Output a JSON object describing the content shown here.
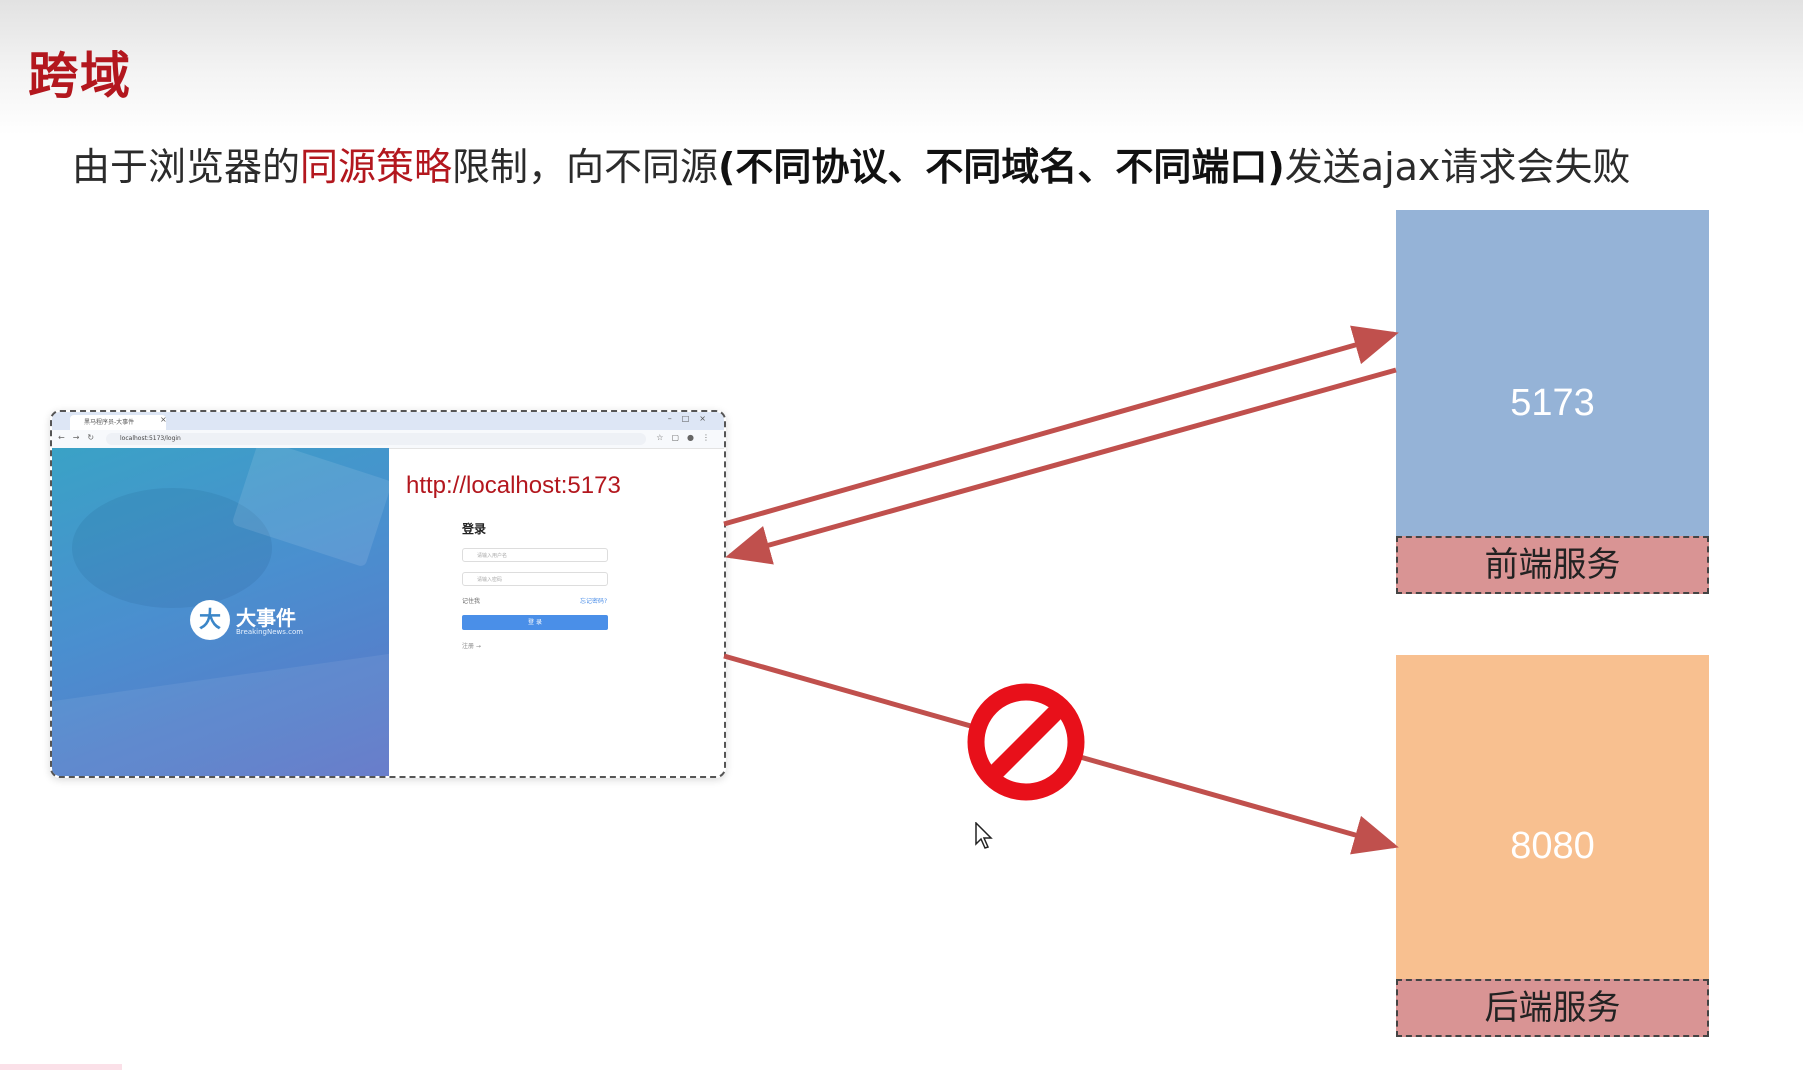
{
  "slide": {
    "title": "跨域",
    "subtitle": {
      "part1": "由于浏览器的",
      "highlight": "同源策略",
      "part2": "限制，向不同源",
      "bold": "(不同协议、不同域名、不同端口)",
      "part3": "发送ajax请求会失败"
    }
  },
  "browser": {
    "tab_title": "黑马程序员-大事件",
    "address": "localhost:5173/login",
    "page_url_label": "http://localhost:5173",
    "logo_name": "大事件",
    "logo_sub": "BreakingNews.com",
    "login": {
      "title": "登录",
      "username_placeholder": "请输入用户名",
      "password_placeholder": "请输入密码",
      "remember": "记住我",
      "forgot": "忘记密码?",
      "button": "登 录",
      "register": "注册 →"
    }
  },
  "servers": {
    "frontend": {
      "port": "5173",
      "label": "前端服务"
    },
    "backend": {
      "port": "8080",
      "label": "后端服务"
    }
  },
  "colors": {
    "accent": "#b3171e",
    "arrow": "#c0504d",
    "frontend_box": "#95b3d7",
    "backend_box": "#f8c090",
    "label_box": "#d99494",
    "blocked_icon": "#e8101a"
  }
}
